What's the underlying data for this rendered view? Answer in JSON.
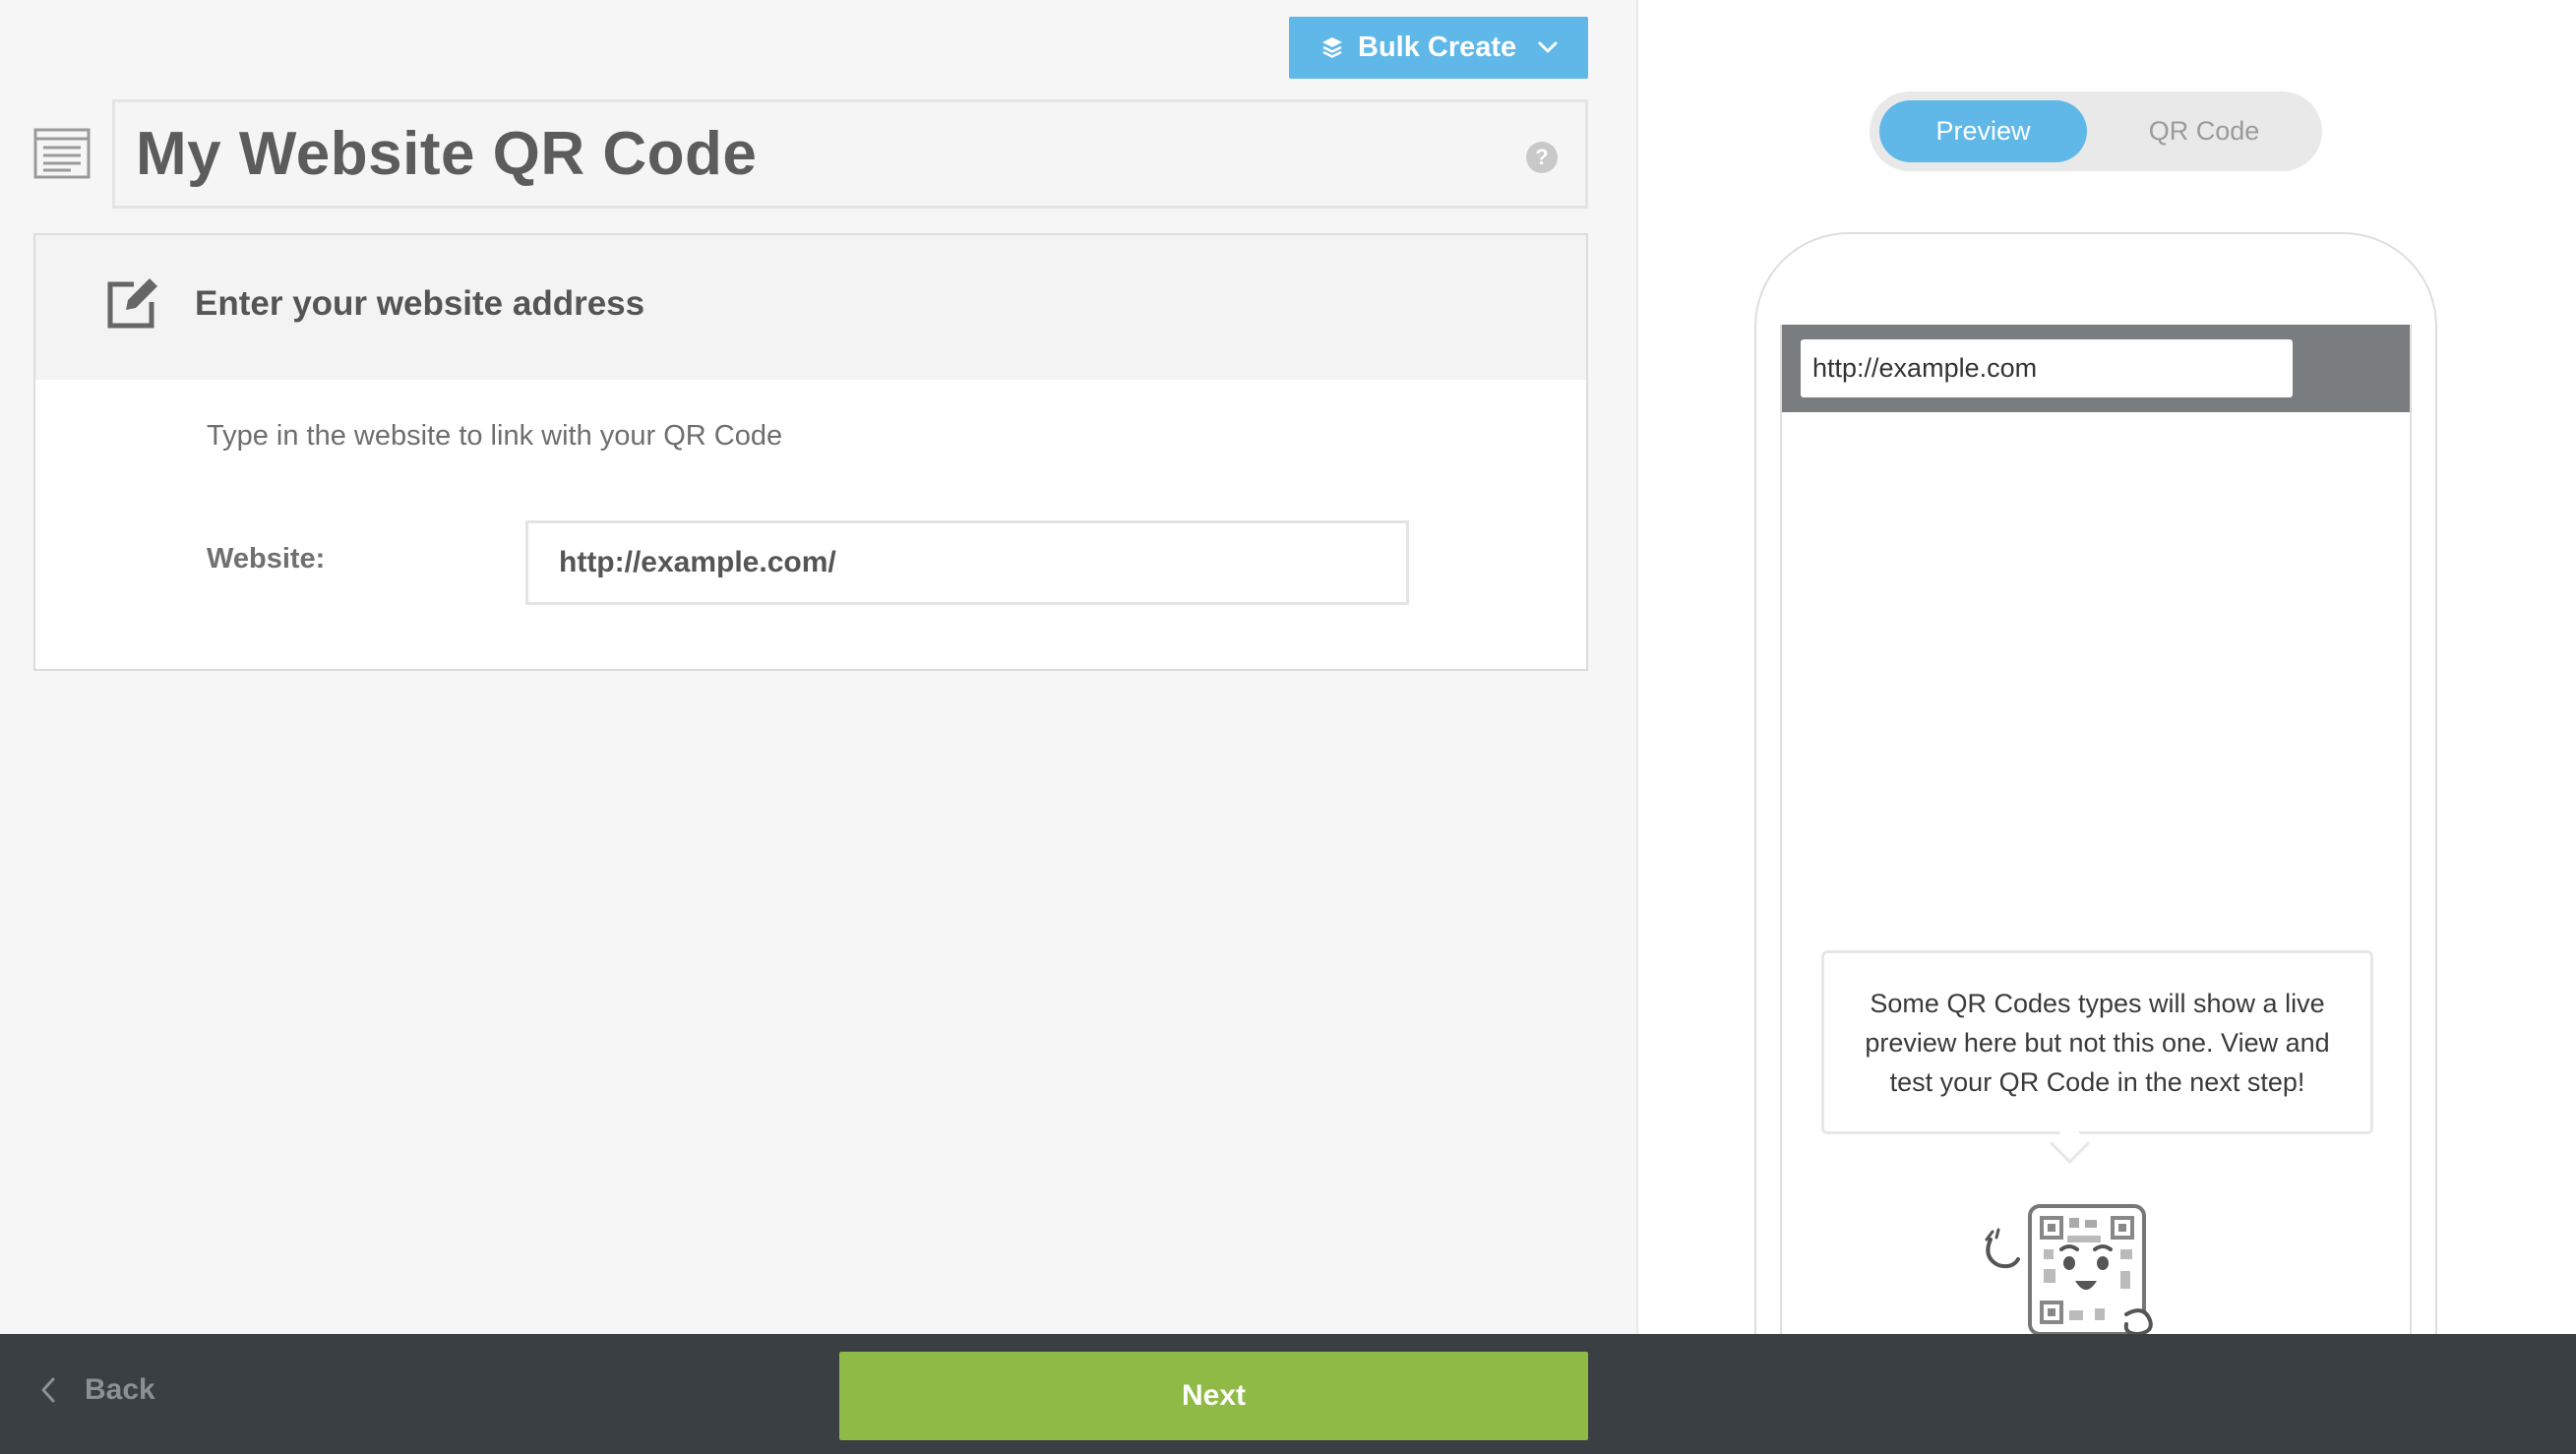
{
  "header": {
    "bulk_create_label": "Bulk Create",
    "title": "My Website QR Code",
    "help_glyph": "?"
  },
  "card": {
    "heading": "Enter your website address",
    "description": "Type in the website to link with your QR Code",
    "website_label": "Website:",
    "website_value": "http://example.com/"
  },
  "preview": {
    "toggle": {
      "preview_label": "Preview",
      "qr_label": "QR Code",
      "active": "Preview"
    },
    "url": "http://example.com",
    "message": "Some QR Codes types will show a live preview here but not this one. View and test your QR Code in the next step!"
  },
  "footer": {
    "back_label": "Back",
    "next_label": "Next"
  },
  "colors": {
    "accent_blue": "#60b8e8",
    "next_green": "#8fba45",
    "footer_bg": "#3a3f43"
  },
  "icons": [
    "layers-icon",
    "chevron-down-icon",
    "document-icon",
    "help-icon",
    "edit-icon",
    "chevron-left-icon",
    "qr-mascot-illustration"
  ]
}
